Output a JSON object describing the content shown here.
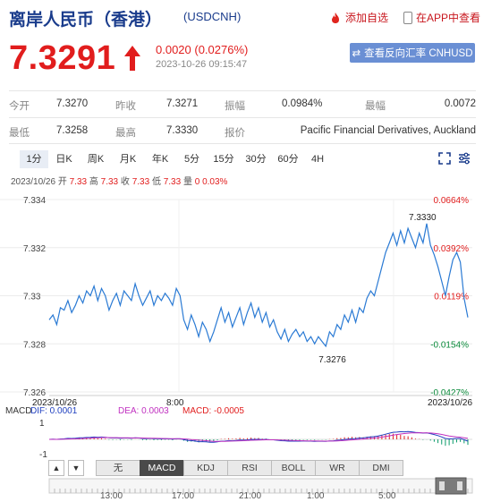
{
  "header": {
    "title": "离岸人民币（香港）",
    "code": "(USDCNH)",
    "add_watch": "添加自选",
    "app_view": "在APP中查看"
  },
  "quote": {
    "price": "7.3291",
    "change": "0.0020 (0.0276%)",
    "time": "2023-10-26 09:15:47",
    "switch_label": "查看反向汇率 CNHUSD",
    "direction": "up",
    "color": "#e11d1d"
  },
  "stats": {
    "open_label": "今开",
    "open": "7.3270",
    "prev_label": "昨收",
    "prev": "7.3271",
    "amp_label": "振幅",
    "amp": "0.0984%",
    "spread_label": "最幅",
    "spread": "0.0072",
    "low_label": "最低",
    "low": "7.3258",
    "high_label": "最高",
    "high": "7.3330",
    "source_label": "报价",
    "source": "Pacific Financial Derivatives, Auckland"
  },
  "tabs": [
    "1分",
    "日K",
    "周K",
    "月K",
    "年K",
    "5分",
    "15分",
    "30分",
    "60分",
    "4H"
  ],
  "quote_line": {
    "date": "2023/10/26",
    "open_label": "开",
    "open": "7.33",
    "high_label": "高",
    "high": "7.33",
    "close_label": "收",
    "close": "7.33",
    "low_label": "低",
    "low": "7.33",
    "vol_label": "量",
    "vol": "0",
    "pct": "0.03%"
  },
  "chart_data": {
    "type": "line",
    "y_ticks": [
      "7.334",
      "7.332",
      "7.33",
      "7.328",
      "7.326"
    ],
    "ylim": [
      7.326,
      7.334
    ],
    "pct_ticks": [
      "0.0664%",
      "0.0392%",
      "0.0119%",
      "-0.0154%",
      "-0.0427%"
    ],
    "x_labels": [
      "2023/10/26",
      "8:00",
      "2023/10/26"
    ],
    "annotations": {
      "high": "7.3330",
      "low": "7.3276"
    },
    "series": [
      {
        "values": [
          7.329,
          7.3292,
          7.3288,
          7.3295,
          7.3294,
          7.3298,
          7.3293,
          7.3296,
          7.33,
          7.3297,
          7.3302,
          7.33,
          7.3304,
          7.3298,
          7.3303,
          7.33,
          7.3294,
          7.3298,
          7.3301,
          7.3296,
          7.3302,
          7.33,
          7.3298,
          7.3305,
          7.33,
          7.3296,
          7.3299,
          7.3302,
          7.3296,
          7.33,
          7.3298,
          7.3301,
          7.3299,
          7.3296,
          7.3303,
          7.33,
          7.329,
          7.3286,
          7.3292,
          7.3288,
          7.3283,
          7.3289,
          7.3286,
          7.3281,
          7.3285,
          7.329,
          7.3295,
          7.3289,
          7.3293,
          7.3287,
          7.3291,
          7.3295,
          7.3288,
          7.3293,
          7.3297,
          7.3291,
          7.3295,
          7.3289,
          7.3293,
          7.3287,
          7.329,
          7.3285,
          7.3282,
          7.3286,
          7.3281,
          7.3284,
          7.3286,
          7.3283,
          7.3285,
          7.3281,
          7.3283,
          7.328,
          7.3283,
          7.3281,
          7.3279,
          7.3285,
          7.3283,
          7.3288,
          7.3286,
          7.3292,
          7.3289,
          7.3294,
          7.3289,
          7.3295,
          7.3293,
          7.3299,
          7.3302,
          7.33,
          7.3306,
          7.3312,
          7.3318,
          7.3322,
          7.3326,
          7.3321,
          7.3327,
          7.3322,
          7.3328,
          7.3324,
          7.332,
          7.3326,
          7.3322,
          7.333,
          7.3321,
          7.3317,
          7.3312,
          7.3306,
          7.33,
          7.3308,
          7.3315,
          7.3318,
          7.3314,
          7.3299,
          7.3291
        ]
      }
    ]
  },
  "macd": {
    "name_label": "MACD",
    "dif": "DIF: 0.0001",
    "dea": "DEA: 0.0003",
    "macd": "MACD: -0.0005",
    "y_top": "1",
    "y_bottom": "-1",
    "dif_color": "#2040c0",
    "dea_color": "#c030c0"
  },
  "indicator_tabs": [
    "无",
    "MACD",
    "KDJ",
    "RSI",
    "BOLL",
    "WR",
    "DMI"
  ],
  "indicator_active": "MACD",
  "timeline": [
    "13:00",
    "17:00",
    "21:00",
    "1:00",
    "5:00"
  ]
}
